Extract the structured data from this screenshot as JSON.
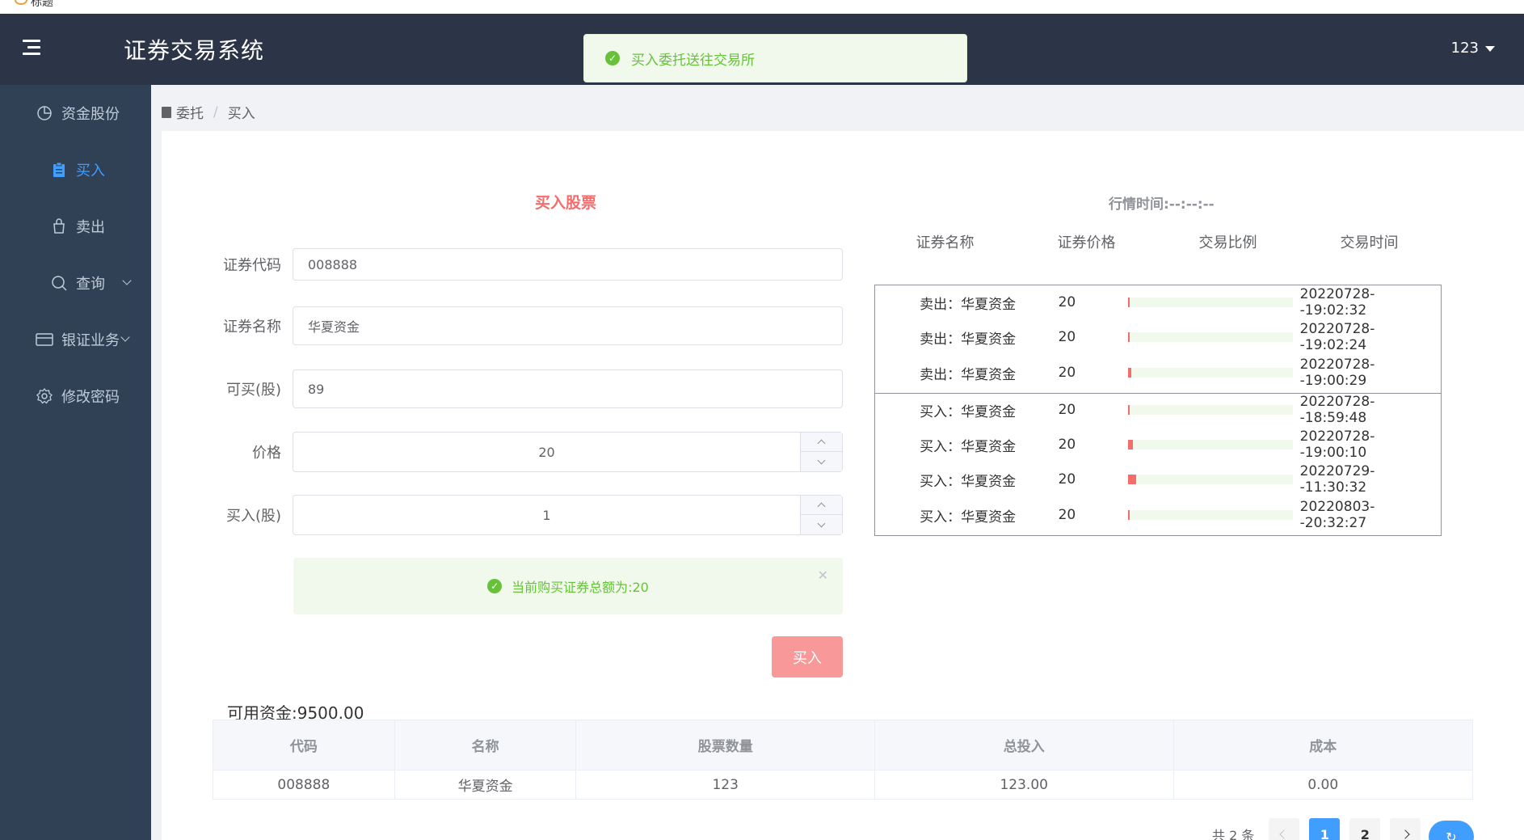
{
  "window": {
    "tab_text": "标题"
  },
  "header": {
    "app_title": "证券交易系统",
    "user": "123"
  },
  "toast": {
    "message": "买入委托送往交易所"
  },
  "sidebar": {
    "items": [
      {
        "label": "资金股份",
        "icon": "pie-chart-icon"
      },
      {
        "label": "买入",
        "icon": "clipboard-icon"
      },
      {
        "label": "卖出",
        "icon": "bag-icon"
      },
      {
        "label": "查询",
        "icon": "search-icon"
      },
      {
        "label": "银证业务",
        "icon": "card-icon"
      },
      {
        "label": "修改密码",
        "icon": "gear-icon"
      }
    ]
  },
  "breadcrumb": {
    "parent": "委托",
    "separator": "/",
    "current": "买入"
  },
  "form": {
    "title": "买入股票",
    "code_label": "证券代码",
    "code_value": "008888",
    "name_label": "证券名称",
    "name_value": "华夏资金",
    "avail_label": "可买(股)",
    "avail_value": "89",
    "price_label": "价格",
    "price_value": "20",
    "qty_label": "买入(股)",
    "qty_value": "1",
    "alert_text": "当前购买证券总额为:20",
    "buy_button": "买入"
  },
  "funds": {
    "available": "可用资金:9500.00"
  },
  "holdings": {
    "columns": [
      "代码",
      "名称",
      "股票数量",
      "总投入",
      "成本"
    ],
    "rows": [
      [
        "008888",
        "华夏资金",
        "123",
        "123.00",
        "0.00"
      ]
    ]
  },
  "pagination": {
    "total": "共 2 条",
    "pages": [
      "1",
      "2"
    ],
    "current": "1"
  },
  "market": {
    "title": "行情时间:--:--:--",
    "columns": [
      "证券名称",
      "证券价格",
      "交易比例",
      "交易时间"
    ],
    "sells": [
      {
        "name": "卖出：华夏资金",
        "price": "20",
        "ratio": 0.01,
        "time": "20220728--19:02:32"
      },
      {
        "name": "卖出：华夏资金",
        "price": "20",
        "ratio": 0.01,
        "time": "20220728--19:02:24"
      },
      {
        "name": "卖出：华夏资金",
        "price": "20",
        "ratio": 0.02,
        "time": "20220728--19:00:29"
      }
    ],
    "buys": [
      {
        "name": "买入：华夏资金",
        "price": "20",
        "ratio": 0.01,
        "time": "20220728--18:59:48"
      },
      {
        "name": "买入：华夏资金",
        "price": "20",
        "ratio": 0.03,
        "time": "20220728--19:00:10"
      },
      {
        "name": "买入：华夏资金",
        "price": "20",
        "ratio": 0.05,
        "time": "20220729--11:30:32"
      },
      {
        "name": "买入：华夏资金",
        "price": "20",
        "ratio": 0.01,
        "time": "20220803--20:32:27"
      }
    ],
    "bar_color": "#f56c6c",
    "bar_track_color": "#f0f9eb"
  },
  "colors": {
    "header_bg": "#2b3547",
    "sidebar_bg": "#304156",
    "accent": "#409eff",
    "danger": "#f56c6c",
    "success": "#67c23a"
  }
}
